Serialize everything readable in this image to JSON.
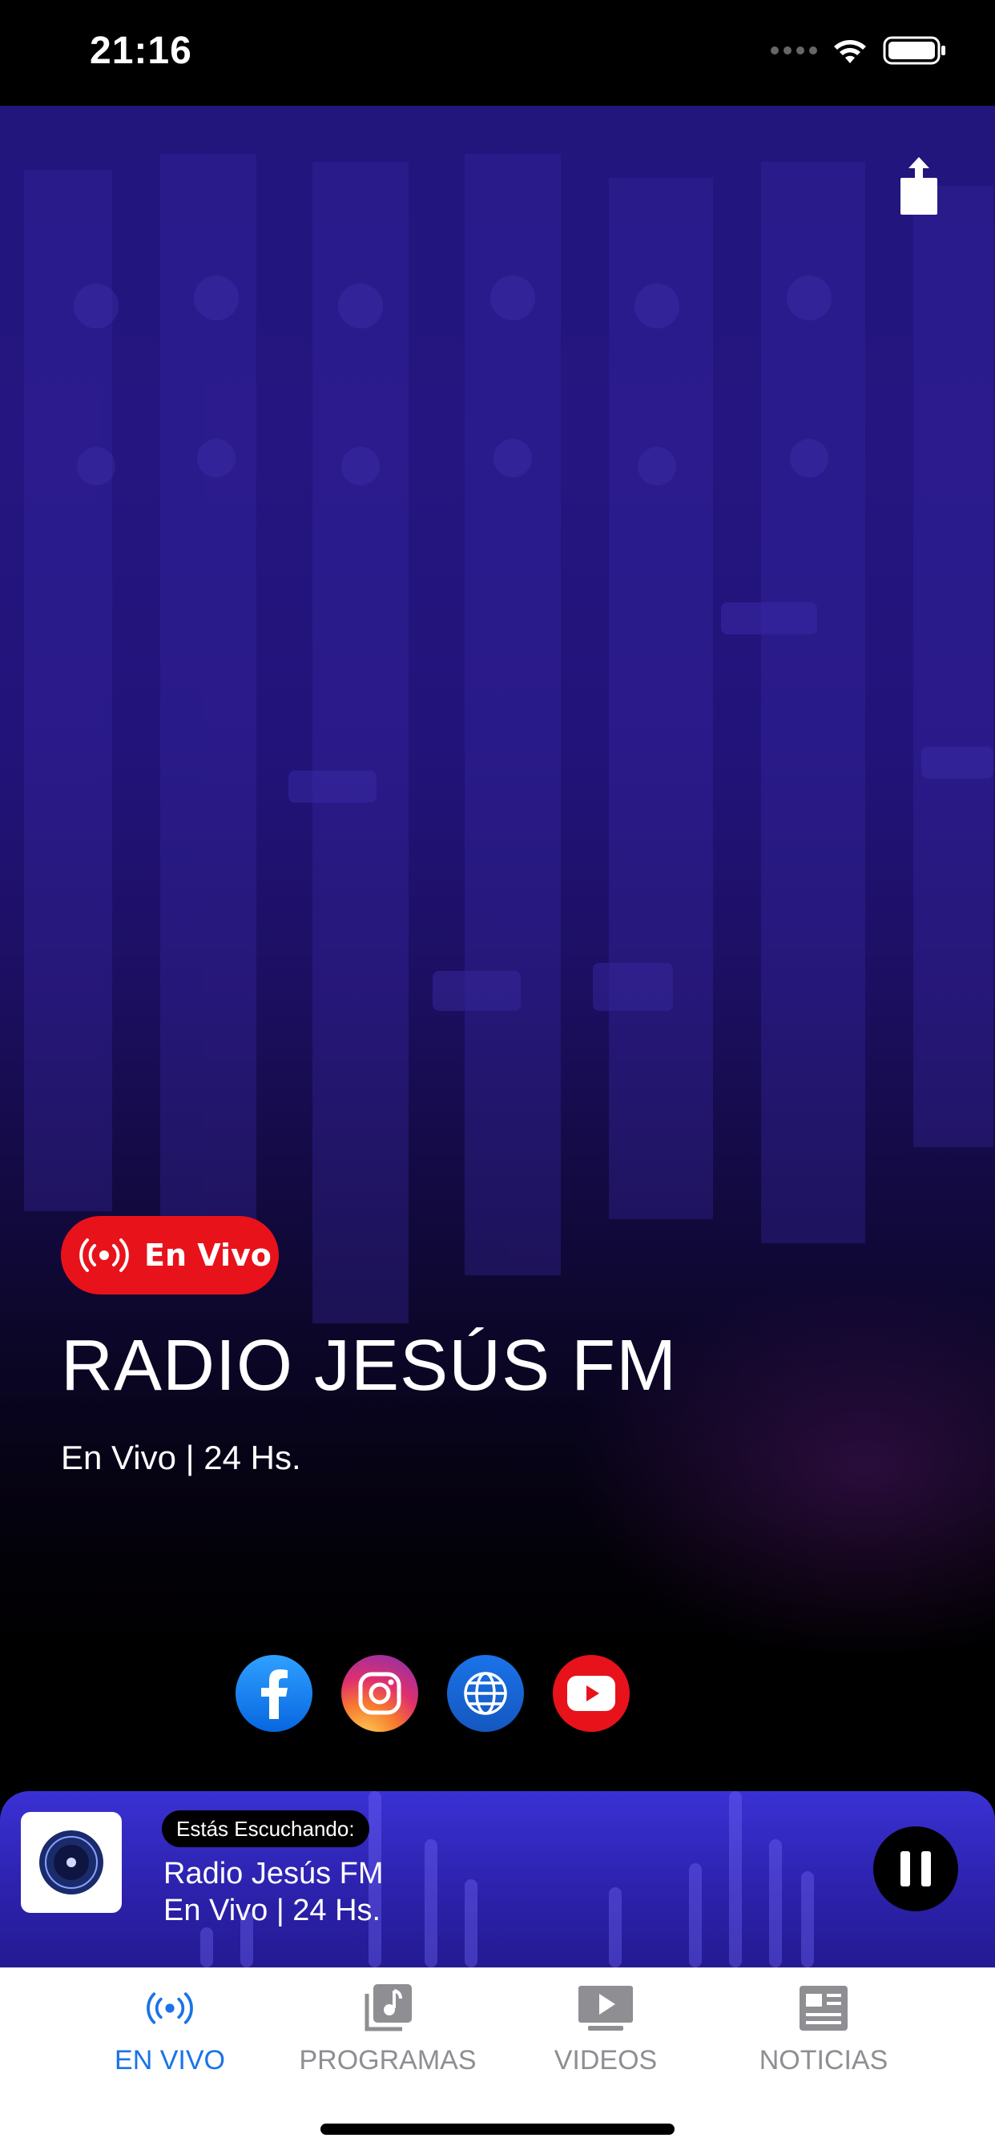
{
  "status_bar": {
    "time": "21:16",
    "icons": [
      "cellular-icon",
      "wifi-icon",
      "battery-icon"
    ]
  },
  "header": {
    "share_icon": "share-icon"
  },
  "hero": {
    "badge_label": "En Vivo",
    "badge_icon": "broadcast-icon",
    "title": "RADIO JESÚS FM",
    "subtitle": "En Vivo | 24 Hs."
  },
  "social": [
    {
      "name": "facebook-icon"
    },
    {
      "name": "instagram-icon"
    },
    {
      "name": "globe-icon"
    },
    {
      "name": "youtube-icon"
    }
  ],
  "player": {
    "badge": "Estás Escuchando:",
    "title": "Radio Jesús FM",
    "subtitle": "En Vivo | 24 Hs.",
    "action_icon": "pause-icon"
  },
  "tabs": [
    {
      "label": "EN VIVO",
      "icon": "broadcast-icon",
      "active": true
    },
    {
      "label": "PROGRAMAS",
      "icon": "music-library-icon",
      "active": false
    },
    {
      "label": "VIDEOS",
      "icon": "video-play-icon",
      "active": false
    },
    {
      "label": "NOTICIAS",
      "icon": "newspaper-icon",
      "active": false
    }
  ],
  "colors": {
    "accent": "#1a73e8",
    "live_red": "#e8121b",
    "player_bg": "#2c22ad",
    "tab_inactive": "#8e8e93"
  }
}
